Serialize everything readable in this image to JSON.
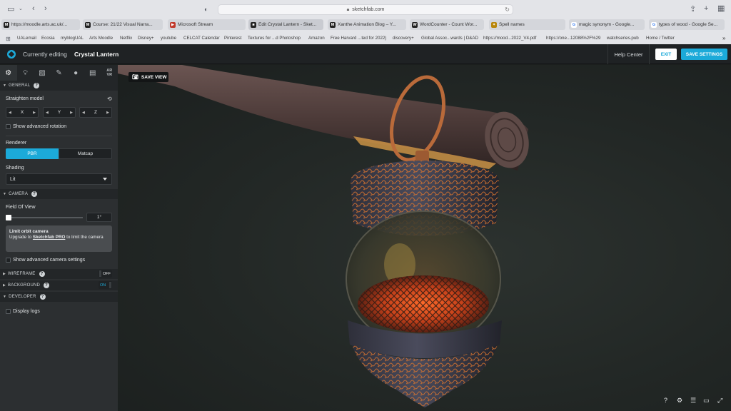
{
  "browser": {
    "url": "sketchfab.com",
    "tabs": [
      {
        "label": "https://moodle.arts.ac.uk/...",
        "favicon": "M"
      },
      {
        "label": "Course: 21/22 Visual Narra...",
        "favicon": "M"
      },
      {
        "label": "Microsoft Stream",
        "favicon": "S"
      },
      {
        "label": "Edit Crystal Lantern - Sket...",
        "favicon": "S"
      },
      {
        "label": "Xanthe Animation Blog – Y...",
        "favicon": "M"
      },
      {
        "label": "WordCounter - Count Wor...",
        "favicon": "W"
      },
      {
        "label": "Spell names",
        "favicon": "✦"
      },
      {
        "label": "magic synonym - Google...",
        "favicon": "G"
      },
      {
        "label": "types of wood - Google Se...",
        "favicon": "G"
      }
    ],
    "bookmarks": [
      "UALemail",
      "Ecosia",
      "myblogUAL",
      "Arts Moodle",
      "Netflix",
      "Disney+",
      "youtube",
      "CELCAT Calendar",
      "Pinterest",
      "Textures for ...d Photoshop",
      "Amazon",
      "Free Harvard ...ted for 2022)",
      "discovery+",
      "Global Assoc...wards | D&AD",
      "https://mood...2022_V4.pdf",
      "https://one...12088%2F%29",
      "watchseries.pub",
      "Home / Twitter"
    ]
  },
  "header": {
    "editing_label": "Currently editing",
    "model_name": "Crystal Lantern",
    "help_center": "Help Center",
    "exit": "EXIT",
    "save_settings": "SAVE SETTINGS"
  },
  "sidebar": {
    "tabs": [
      "gear-icon",
      "lightbulb-icon",
      "image-icon",
      "pencil-icon",
      "drop-icon",
      "film-icon",
      "ar-vr-icon"
    ],
    "ar_vr_label": "AR\nVR",
    "general": {
      "header": "GENERAL",
      "straighten_model": "Straighten model",
      "axes": [
        "X",
        "Y",
        "Z"
      ],
      "show_advanced_rotation": "Show advanced rotation",
      "renderer_label": "Renderer",
      "renderer_options": [
        "PBR",
        "Matcap"
      ],
      "renderer_selected": "PBR",
      "shading_label": "Shading",
      "shading_value": "Lit"
    },
    "camera": {
      "header": "CAMERA",
      "fov_label": "Field Of View",
      "fov_value": "1°",
      "fov_level": 0.0,
      "limit_title": "Limit orbit camera",
      "limit_text_pre": "Upgrade to ",
      "limit_pro": "Sketchfab PRO",
      "limit_text_post": " to limit the camera",
      "show_advanced": "Show advanced camera settings"
    },
    "wireframe": {
      "header": "WIREFRAME",
      "state": "OFF"
    },
    "background": {
      "header": "BACKGROUND",
      "state": "ON"
    },
    "developer": {
      "header": "DEVELOPER",
      "display_logs": "Display logs"
    }
  },
  "viewport": {
    "save_view": "SAVE VIEW",
    "bottom_icons": [
      "help-icon",
      "settings-icon",
      "layers-icon",
      "vr-icon",
      "fullscreen-icon"
    ],
    "help_glyph": "?"
  },
  "colors": {
    "accent": "#1caad9",
    "panel": "#2c2f31",
    "header": "#1f2224"
  }
}
